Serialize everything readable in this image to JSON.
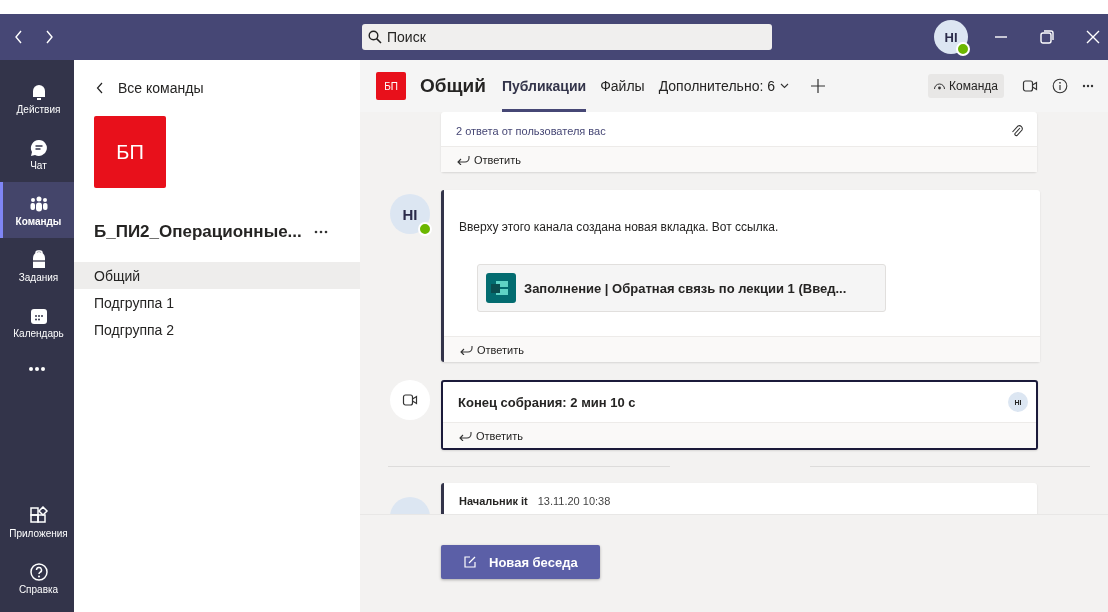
{
  "titlebar": {
    "search": {
      "placeholder": "Поиск"
    },
    "user": {
      "initials": "HI",
      "online": true
    }
  },
  "rail": {
    "items": [
      {
        "label": "Действия",
        "kind": "bell",
        "selected": false
      },
      {
        "label": "Чат",
        "kind": "chat",
        "selected": false
      },
      {
        "label": "Команды",
        "kind": "teams",
        "selected": true
      },
      {
        "label": "Задания",
        "kind": "bag",
        "selected": false
      },
      {
        "label": "Календарь",
        "kind": "calendar",
        "selected": false
      }
    ],
    "bottom_items": [
      {
        "label": "Приложения",
        "kind": "apps"
      },
      {
        "label": "Справка",
        "kind": "help"
      }
    ]
  },
  "team_panel": {
    "back_link": "Все команды",
    "avatar": "БП",
    "name": "Б_ПИ2_Операционные...",
    "channels": [
      {
        "label": "Общий",
        "selected": true
      },
      {
        "label": "Подгруппа 1",
        "selected": false
      },
      {
        "label": "Подгруппа 2",
        "selected": false
      }
    ]
  },
  "channel_header": {
    "avatar": "БП",
    "title": "Общий",
    "tabs": [
      {
        "label": "Публикации",
        "selected": true,
        "kind": "tab"
      },
      {
        "label": "Файлы",
        "selected": false,
        "kind": "tab"
      },
      {
        "label": "Дополнительно: 6",
        "selected": false,
        "kind": "dropdown"
      }
    ],
    "team_button": "Команда"
  },
  "messages": [
    {
      "kind": "thread",
      "replies": "2 ответа от пользователя вас",
      "reply": "Ответить"
    },
    {
      "kind": "post",
      "avatar": "HI",
      "online": true,
      "text": "Вверху этого канала создана новая вкладка. Вот ссылка.",
      "link": "Заполнение | Обратная связь по лекции 1 (Введ...",
      "reply": "Ответить"
    },
    {
      "kind": "meeting",
      "text": "Конец собрания: 2 мин 10 с",
      "participant": "HI",
      "reply": "Ответить"
    },
    {
      "kind": "header",
      "author": "Начальник it",
      "time": "13.11.20 10:38"
    }
  ],
  "new_conversation": "Новая беседа"
}
